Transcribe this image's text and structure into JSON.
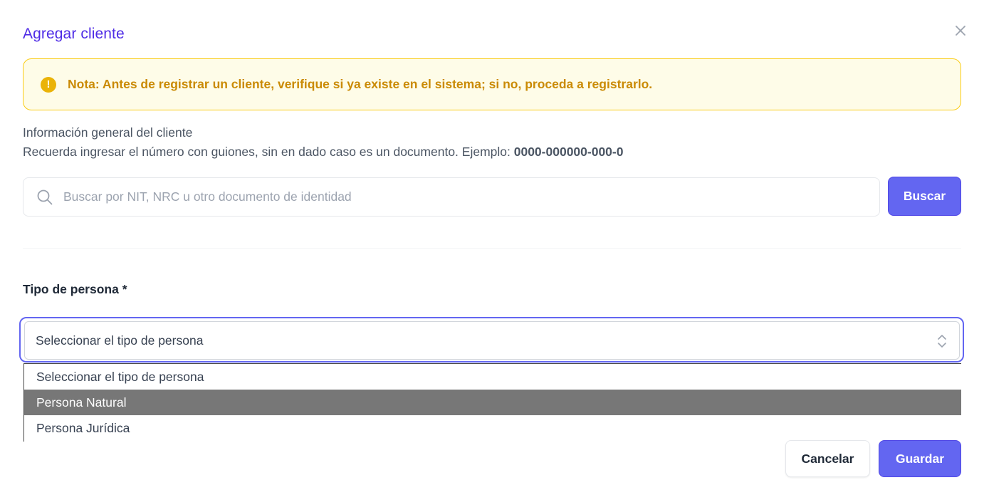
{
  "modal": {
    "title": "Agregar cliente"
  },
  "alert": {
    "icon": "exclamation-icon",
    "message": "Nota: Antes de registrar un cliente, verifique si ya existe en el sistema; si no, proceda a registrarlo."
  },
  "info": {
    "line1": "Información general del cliente",
    "line2_prefix": "Recuerda ingresar el número con guiones, sin en dado caso es un documento. Ejemplo: ",
    "line2_example": "0000-000000-000-0"
  },
  "search": {
    "placeholder": "Buscar por NIT, NRC u otro documento de identidad",
    "value": "",
    "button_label": "Buscar"
  },
  "person_type": {
    "label": "Tipo de persona *",
    "selected": "Seleccionar el tipo de persona",
    "options": [
      "Seleccionar el tipo de persona",
      "Persona Natural",
      "Persona Jurídica"
    ],
    "highlighted_index": 1
  },
  "footer": {
    "cancel_label": "Cancelar",
    "save_label": "Guardar"
  },
  "colors": {
    "accent": "#6366f1",
    "title": "#4f2ce6",
    "alert_bg": "#fefce8",
    "alert_border": "#facc15",
    "alert_text": "#ca8a04"
  }
}
